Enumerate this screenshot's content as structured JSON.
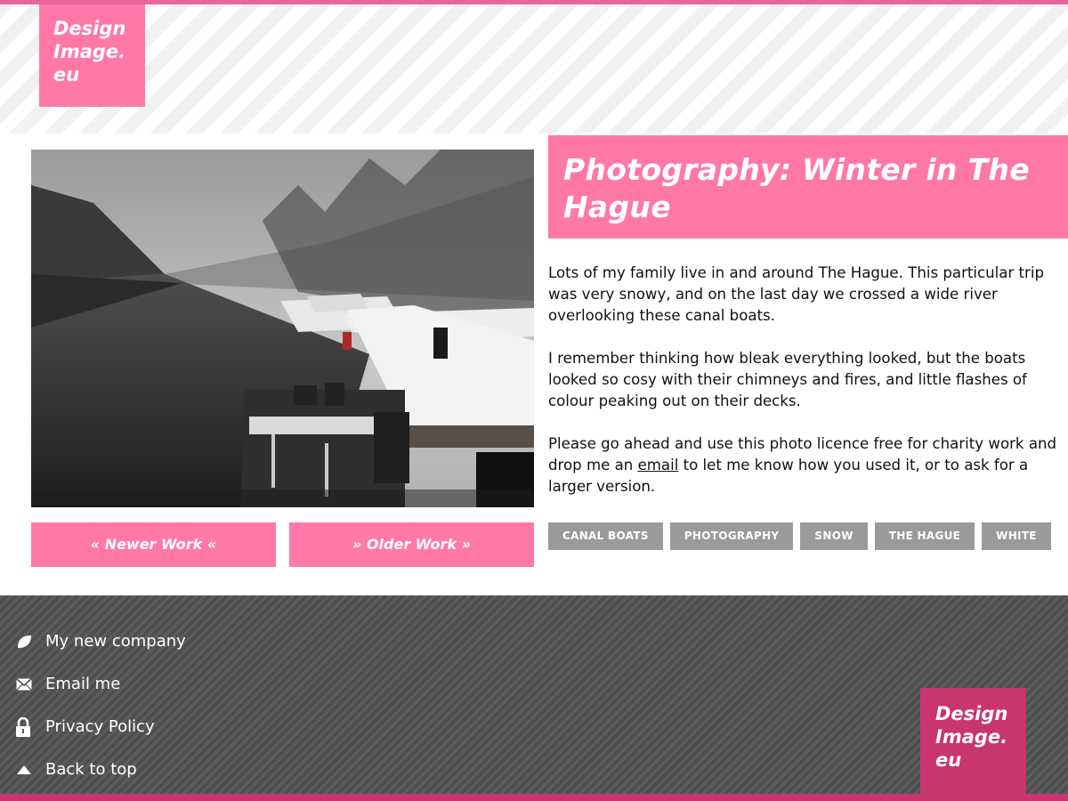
{
  "site": {
    "logo_lines": [
      "Design",
      "Image.",
      "eu"
    ]
  },
  "post": {
    "title": "Photography: Winter in The Hague",
    "paragraphs": [
      "Lots of my family live in and around The Hague. This particular trip was very snowy, and on the last day we crossed a wide river overlooking these canal boats.",
      "I remember thinking how bleak everything looked, but the boats looked so cosy with their chimneys and fires, and little flashes of colour peaking out on their decks."
    ],
    "cta": {
      "before": "Please go ahead and use this photo licence free for charity work and drop me an ",
      "link": "email",
      "after": " to let me know how you used it, or to ask for a larger version."
    },
    "tags": [
      "CANAL BOATS",
      "PHOTOGRAPHY",
      "SNOW",
      "THE HAGUE",
      "WHITE"
    ]
  },
  "nav": {
    "newer": "« Newer Work «",
    "older": "» Older Work »"
  },
  "footer": {
    "links": [
      {
        "label": "My new company",
        "icon": "leaf-icon"
      },
      {
        "label": "Email me",
        "icon": "envelope-icon"
      },
      {
        "label": "Privacy Policy",
        "icon": "lock-icon"
      },
      {
        "label": "Back to top",
        "icon": "triangle-up-icon"
      }
    ]
  },
  "colors": {
    "accent_pink": "#ff78a8",
    "dark_pink": "#c8366e",
    "tag_gray": "#9a9a9a",
    "footer_gray": "#555555"
  }
}
